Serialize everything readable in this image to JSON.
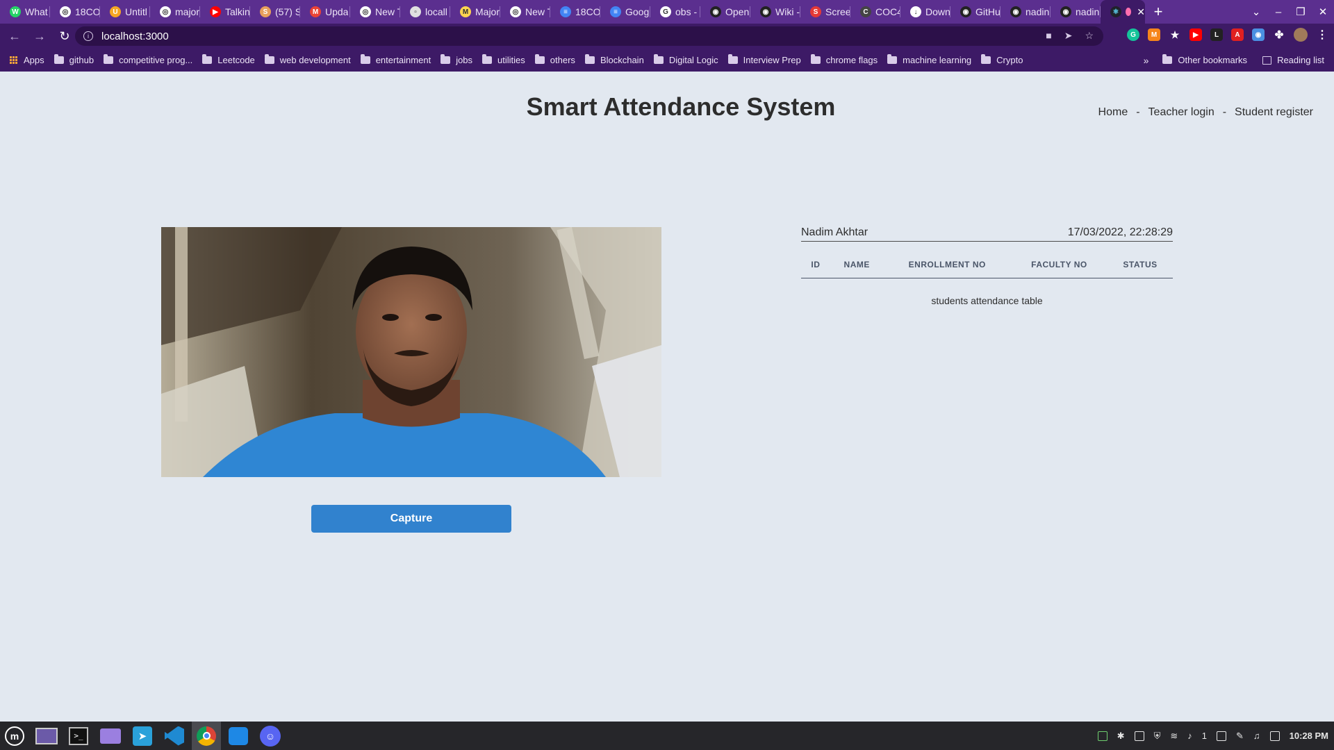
{
  "browser": {
    "tabs": [
      {
        "label": "What",
        "color": "#25d366",
        "glyph": "W"
      },
      {
        "label": "18CO",
        "color": "#ffffff",
        "glyph": "◎"
      },
      {
        "label": "Untitl",
        "color": "#f6a623",
        "glyph": "U"
      },
      {
        "label": "major",
        "color": "#ffffff",
        "glyph": "◎"
      },
      {
        "label": "Talkin",
        "color": "#ff0000",
        "glyph": "▶"
      },
      {
        "label": "(57) S",
        "color": "#e7a05c",
        "glyph": "S"
      },
      {
        "label": "Upda",
        "color": "#ea4335",
        "glyph": "M"
      },
      {
        "label": "New T",
        "color": "#ffffff",
        "glyph": "◎"
      },
      {
        "label": "locall",
        "color": "#e0e0e0",
        "glyph": "▫"
      },
      {
        "label": "Major",
        "color": "#ffd54f",
        "glyph": "M"
      },
      {
        "label": "New T",
        "color": "#ffffff",
        "glyph": "◎"
      },
      {
        "label": "18CO",
        "color": "#4285f4",
        "glyph": "≡"
      },
      {
        "label": "Goog",
        "color": "#4285f4",
        "glyph": "≡"
      },
      {
        "label": "obs -",
        "color": "#ffffff",
        "glyph": "G"
      },
      {
        "label": "Open",
        "color": "#222222",
        "glyph": "◉"
      },
      {
        "label": "Wiki -",
        "color": "#222222",
        "glyph": "◉"
      },
      {
        "label": "Scree",
        "color": "#e53935",
        "glyph": "S"
      },
      {
        "label": "COC4",
        "color": "#444444",
        "glyph": "C"
      },
      {
        "label": "Down",
        "color": "#ffffff",
        "glyph": "↓"
      },
      {
        "label": "GitHu",
        "color": "#222222",
        "glyph": "◉"
      },
      {
        "label": "nadin",
        "color": "#222222",
        "glyph": "◉"
      },
      {
        "label": "nadin",
        "color": "#222222",
        "glyph": "◉"
      }
    ],
    "active_tab": {
      "label": "",
      "color": "#61dafb"
    },
    "new_tab": "+",
    "url": "localhost:3000",
    "bookmarks": [
      "github",
      "competitive prog...",
      "Leetcode",
      "web development",
      "entertainment",
      "jobs",
      "utilities",
      "others",
      "Blockchain",
      "Digital Logic",
      "Interview Prep",
      "chrome flags",
      "machine learning",
      "Crypto"
    ],
    "apps_label": "Apps",
    "other_bookmarks": "Other bookmarks",
    "reading_list": "Reading list"
  },
  "page": {
    "title": "Smart Attendance System",
    "nav": {
      "home": "Home",
      "teacher_login": "Teacher login",
      "student_register": "Student register",
      "separator": "-"
    },
    "capture_label": "Capture",
    "user_name": "Nadim Akhtar",
    "datetime": "17/03/2022, 22:28:29",
    "table": {
      "columns": [
        "ID",
        "NAME",
        "ENROLLMENT NO",
        "FACULTY NO",
        "STATUS"
      ],
      "empty_message": "students attendance table"
    }
  },
  "taskbar": {
    "apps": [
      "mint-menu-icon",
      "workspace-icon",
      "terminal-icon",
      "files-icon",
      "telegram-icon",
      "vscode-icon",
      "chrome-icon",
      "screenshot-icon",
      "discord-icon"
    ],
    "clock": "10:28 PM",
    "tray_count": "1"
  }
}
